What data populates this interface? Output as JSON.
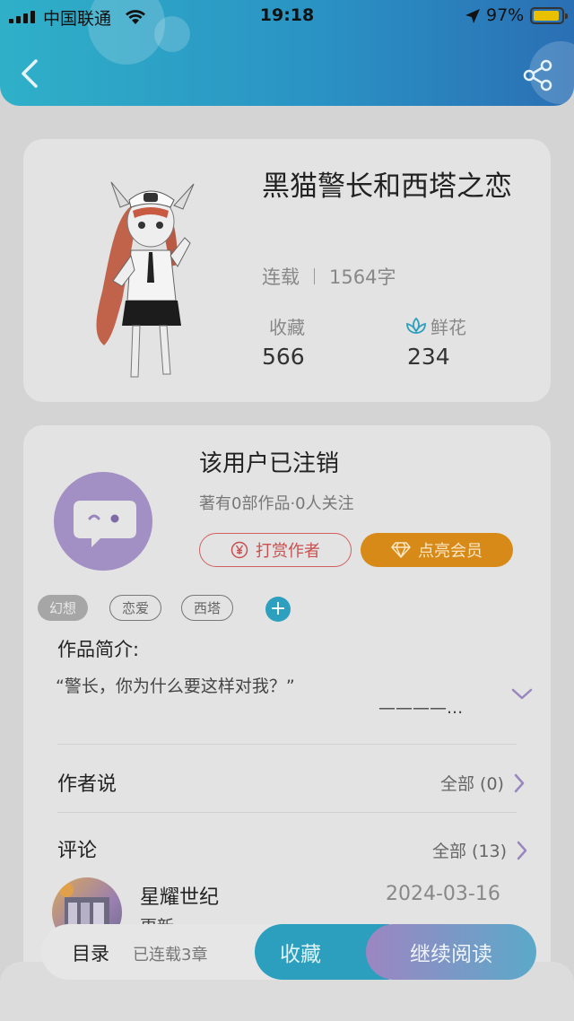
{
  "status_bar": {
    "carrier": "中国联通",
    "time": "19:18",
    "battery": "97%"
  },
  "colors": {
    "header_gradient": [
      "#2fb0c8",
      "#2a6fb4"
    ],
    "accent": "#2b9fbd",
    "vip": "#d78a17",
    "tip": "#c85050"
  },
  "header": {
    "back_icon": "chevron-left-icon",
    "share_icon": "share-icon"
  },
  "book": {
    "title": "黑猫警长和西塔之恋",
    "status": "连载",
    "word_count": "1564字",
    "favorites_label": "收藏",
    "favorites_value": "566",
    "flowers_label": "鲜花",
    "flowers_value": "234"
  },
  "author": {
    "name": "该用户已注销",
    "meta": "著有0部作品·0人关注",
    "tip_button": "打赏作者",
    "vip_button": "点亮会员"
  },
  "tags": [
    "幻想",
    "恋爱",
    "西塔"
  ],
  "intro": {
    "label": "作品简介:",
    "text": "“警长，你为什么要这样对我？”",
    "tail": "————..."
  },
  "author_says": {
    "title": "作者说",
    "link": "全部 (0)"
  },
  "comments": {
    "title": "评论",
    "link": "全部 (13)",
    "items": [
      {
        "user": "星耀世纪",
        "date": "2024-03-16",
        "text": "更新"
      }
    ]
  },
  "bottom_bar": {
    "toc": "目录",
    "chapters": "已连载3章",
    "collect": "收藏",
    "read": "继续阅读"
  }
}
